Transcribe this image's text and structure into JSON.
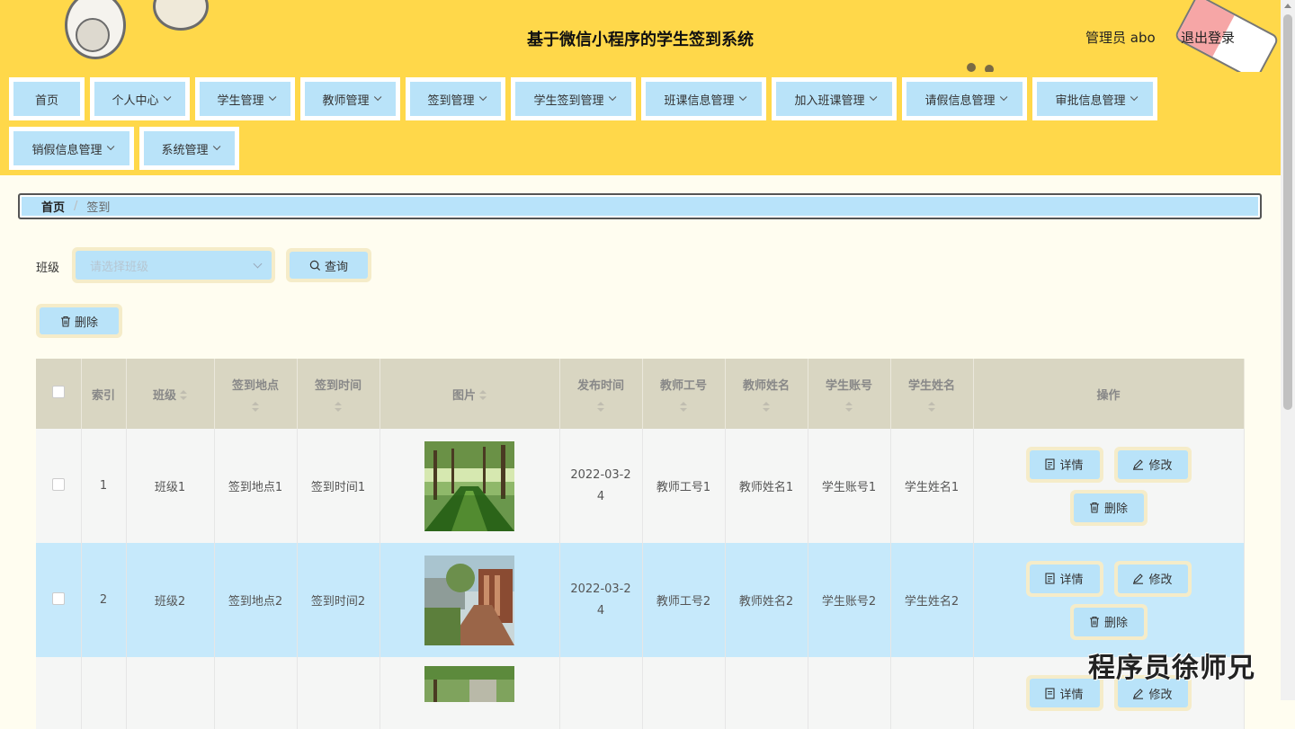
{
  "header": {
    "title": "基于微信小程序的学生签到系统",
    "user": "管理员 abo",
    "logout": "退出登录"
  },
  "menu": [
    {
      "label": "首页",
      "dropdown": false
    },
    {
      "label": "个人中心",
      "dropdown": true
    },
    {
      "label": "学生管理",
      "dropdown": true
    },
    {
      "label": "教师管理",
      "dropdown": true
    },
    {
      "label": "签到管理",
      "dropdown": true
    },
    {
      "label": "学生签到管理",
      "dropdown": true
    },
    {
      "label": "班课信息管理",
      "dropdown": true
    },
    {
      "label": "加入班课管理",
      "dropdown": true
    },
    {
      "label": "请假信息管理",
      "dropdown": true
    },
    {
      "label": "审批信息管理",
      "dropdown": true
    },
    {
      "label": "销假信息管理",
      "dropdown": true
    },
    {
      "label": "系统管理",
      "dropdown": true
    }
  ],
  "breadcrumb": {
    "home": "首页",
    "separator": "/",
    "current": "签到"
  },
  "search": {
    "class_label": "班级",
    "class_placeholder": "请选择班级",
    "query_button": "查询"
  },
  "toolbar": {
    "delete_button": "删除"
  },
  "table": {
    "headers": [
      "",
      "索引",
      "班级",
      "签到地点",
      "签到时间",
      "图片",
      "发布时间",
      "教师工号",
      "教师姓名",
      "学生账号",
      "学生姓名",
      "操作"
    ],
    "rows": [
      {
        "index": "1",
        "class": "班级1",
        "location": "签到地点1",
        "time": "签到时间1",
        "published": "2022-03-24",
        "teacher_id": "教师工号1",
        "teacher_name": "教师姓名1",
        "student_account": "学生账号1",
        "student_name": "学生姓名1"
      },
      {
        "index": "2",
        "class": "班级2",
        "location": "签到地点2",
        "time": "签到时间2",
        "published": "2022-03-24",
        "teacher_id": "教师工号2",
        "teacher_name": "教师姓名2",
        "student_account": "学生账号2",
        "student_name": "学生姓名2"
      }
    ],
    "actions": {
      "detail": "详情",
      "edit": "修改",
      "delete": "删除"
    }
  },
  "colors": {
    "header_bg": "#ffd84a",
    "button_bg": "#b9e3f9",
    "selected_row": "#c6e9fb",
    "table_header_bg": "#d9d6c2"
  },
  "watermark": "程序员徐师兄"
}
